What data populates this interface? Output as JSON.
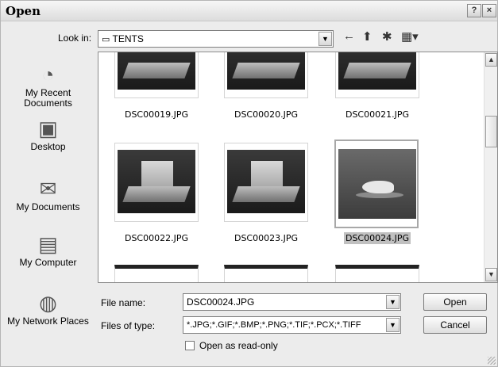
{
  "window": {
    "title": "Open",
    "help_label": "?",
    "close_label": "×"
  },
  "look_in": {
    "label": "Look in:",
    "value": "TENTS"
  },
  "toolbar": {
    "back_icon": "←",
    "up_icon": "⬆",
    "new_folder_icon": "✱",
    "views_icon": "▦▾"
  },
  "places": [
    {
      "label": "My Recent Documents",
      "icon": "◔"
    },
    {
      "label": "Desktop",
      "icon": "▣"
    },
    {
      "label": "My Documents",
      "icon": "✉"
    },
    {
      "label": "My Computer",
      "icon": "▤"
    },
    {
      "label": "My Network Places",
      "icon": "◍"
    }
  ],
  "files": [
    {
      "name": "DSC00019.JPG",
      "selected": false
    },
    {
      "name": "DSC00020.JPG",
      "selected": false
    },
    {
      "name": "DSC00021.JPG",
      "selected": false
    },
    {
      "name": "DSC00022.JPG",
      "selected": false
    },
    {
      "name": "DSC00023.JPG",
      "selected": false
    },
    {
      "name": "DSC00024.JPG",
      "selected": true
    }
  ],
  "file_name": {
    "label": "File name:",
    "value": "DSC00024.JPG"
  },
  "file_type": {
    "label": "Files of type:",
    "value": "*.JPG;*.GIF;*.BMP;*.PNG;*.TIF;*.PCX;*.TIFF"
  },
  "read_only": {
    "label": "Open as read-only",
    "checked": false
  },
  "buttons": {
    "open": "Open",
    "cancel": "Cancel"
  }
}
